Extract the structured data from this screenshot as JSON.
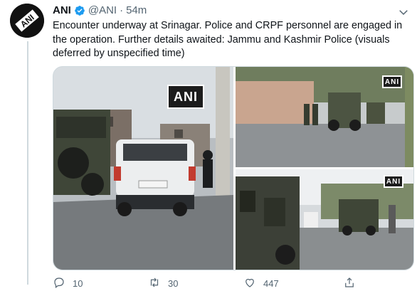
{
  "tweet": {
    "author_name": "ANI",
    "handle": "@ANI",
    "separator": "·",
    "time": "54m",
    "text": "Encounter underway at Srinagar. Police and CRPF personnel are engaged in the operation. Further details awaited: Jammu and Kashmir Police (visuals deferred by unspecified time)",
    "avatar_text": "ANI",
    "verified_color": "#1d9bf0"
  },
  "media": {
    "watermark": "ANI",
    "photos": [
      {
        "name": "encounter-photo-1"
      },
      {
        "name": "encounter-photo-2"
      },
      {
        "name": "encounter-photo-3"
      }
    ]
  },
  "actions": {
    "reply_count": "10",
    "retweet_count": "30",
    "like_count": "447",
    "icons": [
      "reply-icon",
      "retweet-icon",
      "like-icon",
      "share-icon"
    ]
  }
}
